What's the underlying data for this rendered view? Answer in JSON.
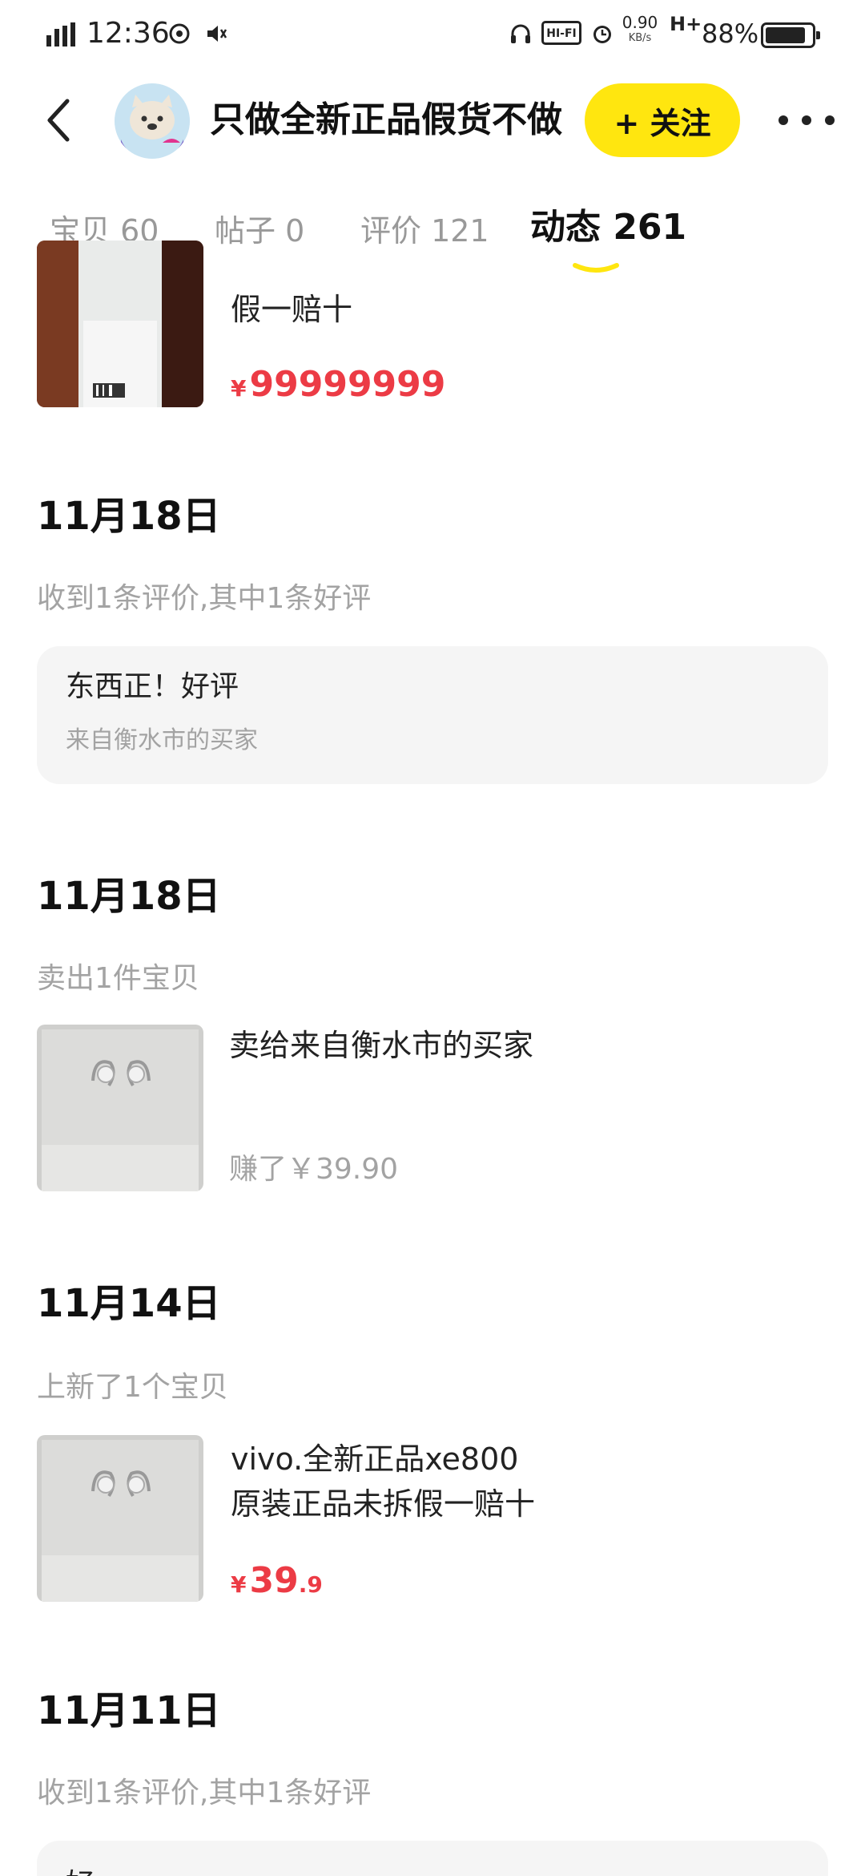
{
  "status_bar": {
    "time": "12:36",
    "net_speed": "0.90",
    "net_unit": "KB/s",
    "hifi": "HI-FI",
    "net_type": "H+",
    "battery": "88%",
    "battery_level": 0.88
  },
  "header": {
    "shop_name": "只做全新正品假货不做",
    "follow_label": "+ 关注"
  },
  "tabs": [
    {
      "label": "宝贝 60"
    },
    {
      "label": "帖子 0"
    },
    {
      "label": "评价 121"
    },
    {
      "label": "动态 261"
    }
  ],
  "feed": {
    "top_item": {
      "title": "假一赔十",
      "currency": "¥",
      "price": "99999999"
    },
    "entries": [
      {
        "date": "11月18日",
        "summary": "收到1条评价,其中1条好评",
        "review_text": "东西正！好评",
        "review_from": "来自衡水市的买家"
      },
      {
        "date": "11月18日",
        "summary": "卖出1件宝贝",
        "title": "卖给来自衡水市的买家",
        "earned": "赚了￥39.90"
      },
      {
        "date": "11月14日",
        "summary": "上新了1个宝贝",
        "title_line1": "vivo.全新正品xe800",
        "title_line2": "原装正品未拆假一赔十",
        "currency": "¥",
        "price_int": "39",
        "price_dec": ".9"
      },
      {
        "date": "11月11日",
        "summary": "收到1条评价,其中1条好评",
        "review_text": "好"
      }
    ]
  },
  "colors": {
    "accent_yellow": "#ffe60f",
    "price_red": "#ec3b45",
    "gray_text": "#a3a3a3",
    "card_bg": "#f5f5f5"
  }
}
